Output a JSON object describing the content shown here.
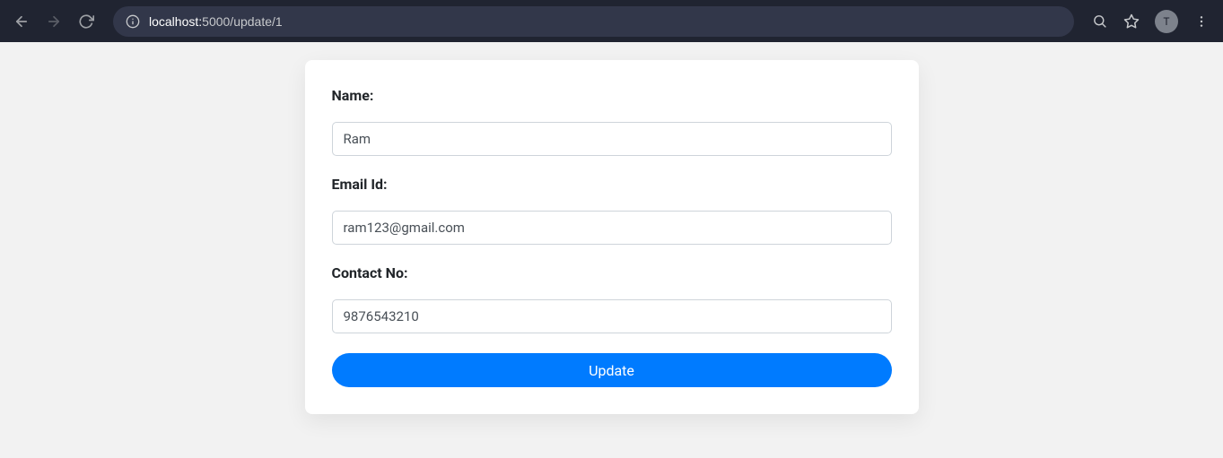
{
  "browser": {
    "url_host": "localhost:",
    "url_path": "5000/update/1",
    "avatar_letter": "T"
  },
  "form": {
    "name_label": "Name:",
    "name_value": "Ram",
    "email_label": "Email Id:",
    "email_value": "ram123@gmail.com",
    "contact_label": "Contact No:",
    "contact_value": "9876543210",
    "submit_label": "Update"
  }
}
